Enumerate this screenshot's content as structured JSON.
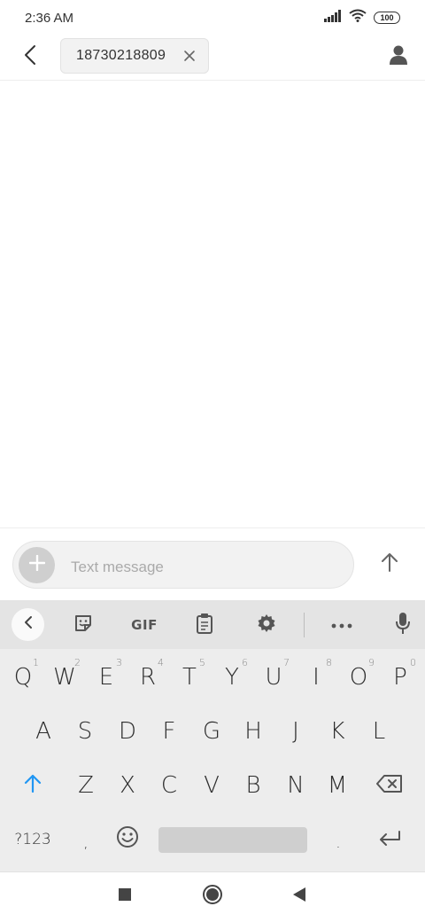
{
  "status_bar": {
    "time": "2:36 AM",
    "battery": "100",
    "icons": [
      "signal-icon",
      "wifi-icon",
      "battery-icon"
    ]
  },
  "header": {
    "recipient": "18730218809",
    "icons": [
      "back-arrow-icon",
      "close-icon",
      "contact-icon"
    ]
  },
  "compose": {
    "placeholder": "Text message",
    "icons": [
      "plus-icon",
      "send-arrow-icon"
    ]
  },
  "keyboard": {
    "toolbar": {
      "gif_label": "GIF",
      "icons": [
        "chevron-left-icon",
        "sticker-icon",
        "clipboard-icon",
        "settings-icon",
        "more-icon",
        "microphone-icon"
      ]
    },
    "rows": {
      "row1": [
        {
          "label": "Q",
          "hint": "1"
        },
        {
          "label": "W",
          "hint": "2"
        },
        {
          "label": "E",
          "hint": "3"
        },
        {
          "label": "R",
          "hint": "4"
        },
        {
          "label": "T",
          "hint": "5"
        },
        {
          "label": "Y",
          "hint": "6"
        },
        {
          "label": "U",
          "hint": "7"
        },
        {
          "label": "I",
          "hint": "8"
        },
        {
          "label": "O",
          "hint": "9"
        },
        {
          "label": "P",
          "hint": "0"
        }
      ],
      "row2": [
        "A",
        "S",
        "D",
        "F",
        "G",
        "H",
        "J",
        "K",
        "L"
      ],
      "row3": [
        "Z",
        "X",
        "C",
        "V",
        "B",
        "N",
        "M"
      ],
      "row4": {
        "symbols": "?123",
        "comma": ",",
        "period": "."
      }
    },
    "accent_color": "#2196f3"
  },
  "nav_bar": {
    "icons": [
      "recents-square-icon",
      "home-circle-icon",
      "back-triangle-icon"
    ]
  }
}
